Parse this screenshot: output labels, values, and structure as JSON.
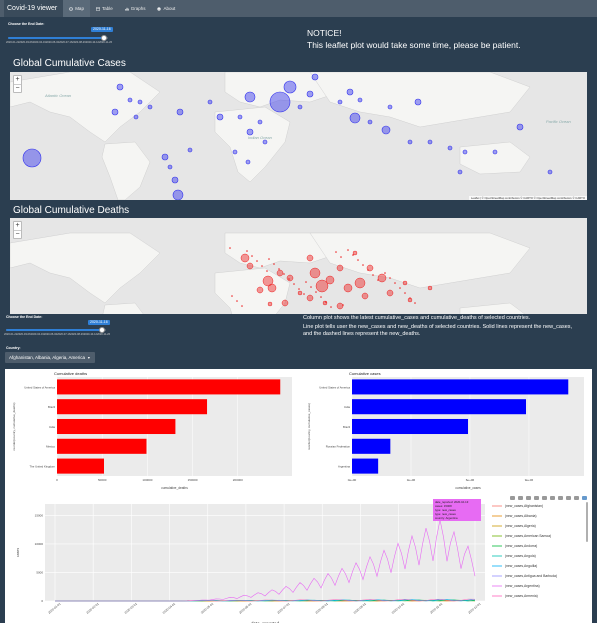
{
  "navbar": {
    "brand": "Covid-19 viewer",
    "tabs": [
      {
        "label": "Map",
        "icon": "globe-icon"
      },
      {
        "label": "Table",
        "icon": "table-icon"
      },
      {
        "label": "Graphs",
        "icon": "chart-icon"
      },
      {
        "label": "About",
        "icon": "info-icon"
      }
    ]
  },
  "map_panel": {
    "slider_label": "Choose the End Date:",
    "slider_value": "2020-11-16",
    "slider_fraction": 0.96,
    "slider_ticks": [
      "2020-01-22",
      "2020-03-06",
      "2020-04-19",
      "2020-06-02",
      "2020-07-16",
      "2020-08-29",
      "2020-10-12",
      "2020-11-26"
    ],
    "notice_title": "NOTICE!",
    "notice_text": "This leaflet plot would take some time, please be patient.",
    "cases_title": "Global Cumulative Cases",
    "deaths_title": "Global Cumulative Deaths",
    "zoom_in": "+",
    "zoom_out": "−",
    "ocean_labels": [
      "Atlantic Ocean",
      "Indian Ocean",
      "Pacific Ocean",
      "Atlantic Ocean",
      "Indian Ocean",
      "Pacific Ocean"
    ],
    "attribution": "Leaflet | © OpenStreetMap contributors © CARTO © OpenStreetMap contributors © CARTO",
    "case_color": "#3333ee",
    "death_color": "#ee2222"
  },
  "graph_panel": {
    "slider_label": "Choose the End Date:",
    "slider_value": "2020-11-16",
    "slider_fraction": 0.96,
    "slider_ticks": [
      "2020-01-22",
      "2020-03-06",
      "2020-04-19",
      "2020-06-02",
      "2020-07-16",
      "2020-08-29",
      "2020-10-12",
      "2020-11-26"
    ],
    "desc_line1": "Column plot shows the latest cumulative_cases and cumulative_deaths of selected countries.",
    "desc_line2": "Line plot tells user the new_cases and new_deaths of selected countries. Solid lines represent the new_cases,",
    "desc_line3": "and the dashed lines represent the new_deaths.",
    "country_label": "Country:",
    "country_value": "Afghanistan, Albania, Algeria, America",
    "deaths_chart": {
      "title": "Cumulative deaths",
      "ylabel": "reorder(country, cumulative_deaths)",
      "xlabel": "cumulative_deaths",
      "categories": [
        "United States of America",
        "Brazil",
        "India",
        "Mexico",
        "The United Kingdom"
      ],
      "values": [
        247000,
        166000,
        131000,
        99000,
        52000
      ],
      "ticks": [
        "0",
        "50000",
        "100000",
        "150000",
        "200000"
      ],
      "xmax": 260000,
      "color": "#ff0000"
    },
    "cases_chart": {
      "title": "Cumulative cases",
      "ylabel": "reorder(country, cumulative_cases)",
      "xlabel": "cumulative_cases",
      "categories": [
        "United States of America",
        "India",
        "Brazil",
        "Russian Federation",
        "Argentina"
      ],
      "values": [
        11000000,
        8850000,
        5900000,
        1950000,
        1330000
      ],
      "ticks": [
        "0e+00",
        "3e+06",
        "6e+06",
        "9e+06"
      ],
      "xmax": 11800000,
      "color": "#0000ff"
    },
    "line_chart": {
      "ylabel": "cases",
      "xlabel": "date_reported",
      "yticks": [
        "0",
        "5000",
        "10000",
        "15000"
      ],
      "xticks": [
        "2020-01-01",
        "2020-02-01",
        "2020-03-01",
        "2020-04-01",
        "2020-05-01",
        "2020-06-01",
        "2020-07-01",
        "2020-08-01",
        "2020-09-01",
        "2020-10-01",
        "2020-11-01",
        "2020-12-01"
      ],
      "tooltip": [
        "date_reported: 2020-10-13",
        "cases: 15008",
        "type: new_cases",
        "type: new_cases",
        "country: Argentina"
      ],
      "legend": [
        {
          "label": "(new_cases,Afghanistan)",
          "color": "#f8766d"
        },
        {
          "label": "(new_cases,Albania)",
          "color": "#e58700"
        },
        {
          "label": "(new_cases,Algeria)",
          "color": "#c99800"
        },
        {
          "label": "(new_cases,American Samoa)",
          "color": "#6bb100"
        },
        {
          "label": "(new_cases,Andorra)",
          "color": "#00ba38"
        },
        {
          "label": "(new_cases,Angola)",
          "color": "#00c0af"
        },
        {
          "label": "(new_cases,Anguilla)",
          "color": "#00b0f6"
        },
        {
          "label": "(new_cases,Antigua and Barbuda)",
          "color": "#9590ff"
        },
        {
          "label": "(new_cases,Argentina)",
          "color": "#e76bf3"
        },
        {
          "label": "(new_cases,Armenia)",
          "color": "#ff62bc"
        }
      ]
    }
  }
}
